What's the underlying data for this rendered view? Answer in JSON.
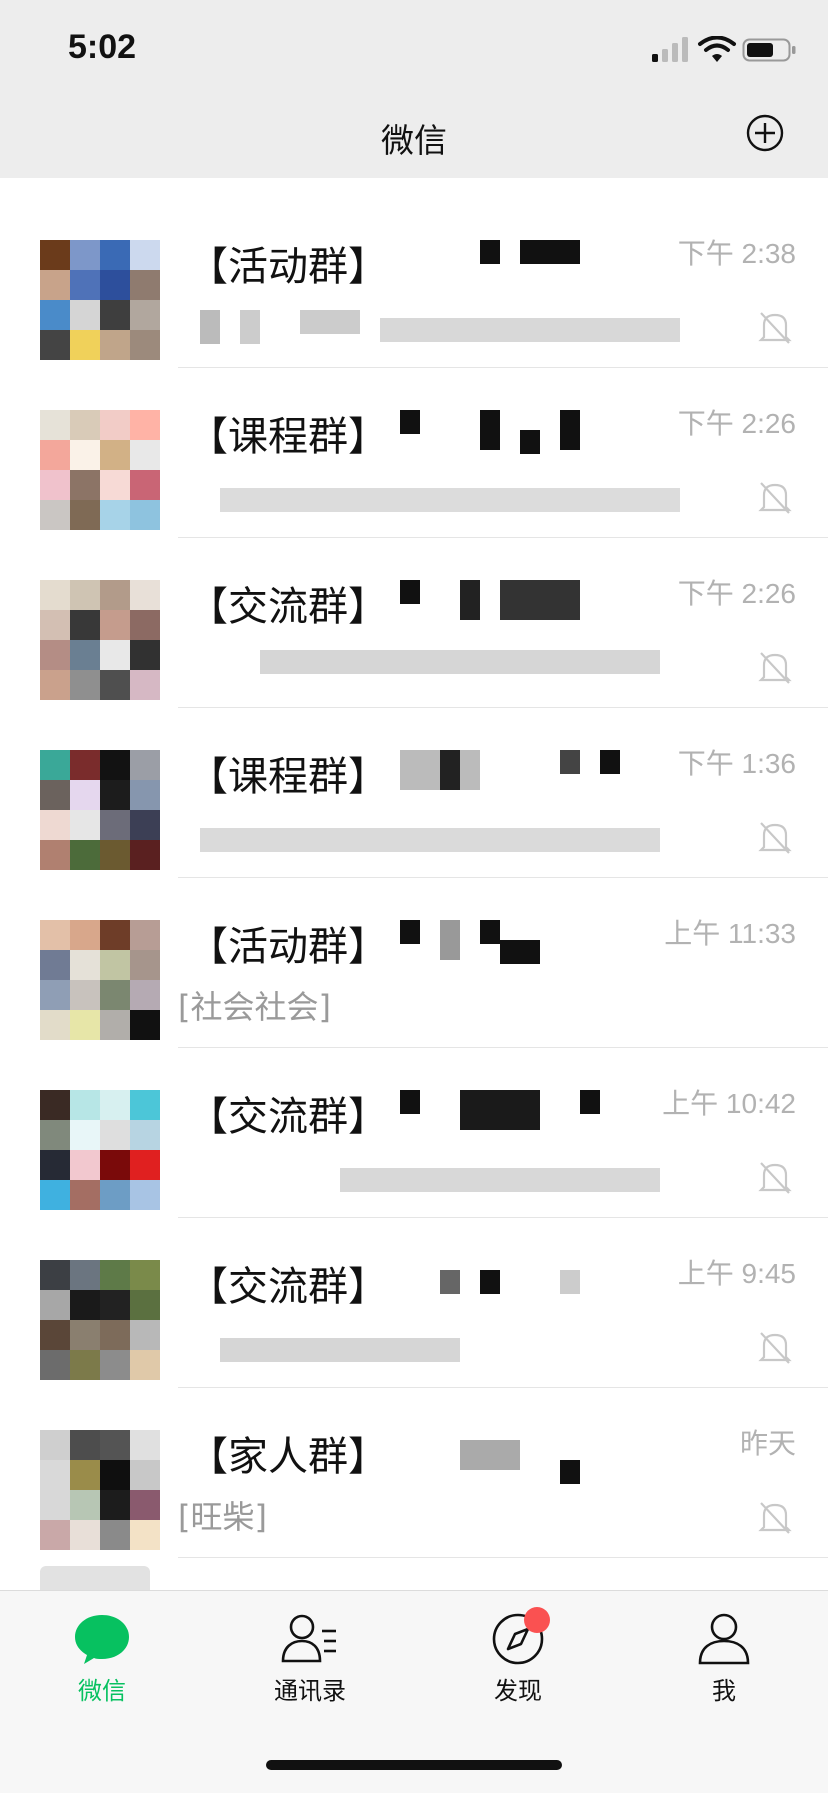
{
  "status_bar": {
    "time": "5:02"
  },
  "header": {
    "title": "微信"
  },
  "chats": [
    {
      "name": "【活动群】",
      "time": "下午 2:38",
      "preview": "",
      "muted": true,
      "avatar": [
        "#6b3b1b",
        "#7d97c9",
        "#3a6ab5",
        "#ccd9ee",
        "#c8a38a",
        "#4f72b8",
        "#2d4f9c",
        "#8f7b6f",
        "#4a8bc9",
        "#d5d5d5",
        "#3e3e3e",
        "#b1a79e",
        "#444444",
        "#f0d15a",
        "#c0a58a",
        "#9c8a7c"
      ]
    },
    {
      "name": "【课程群】",
      "time": "下午 2:26",
      "preview": "",
      "muted": true,
      "avatar": [
        "#e6e2d8",
        "#d9cbb8",
        "#f2ccc7",
        "#ffb3a6",
        "#f3a79b",
        "#faf2e8",
        "#d2b186",
        "#e8e8e8",
        "#f0c2cc",
        "#8c7466",
        "#f7dad6",
        "#c96575",
        "#cac6c3",
        "#7f6a55",
        "#a7d3e8",
        "#8ec3df"
      ]
    },
    {
      "name": "【交流群】",
      "time": "下午 2:26",
      "preview": "",
      "muted": true,
      "avatar": [
        "#e4dccf",
        "#cfc4b3",
        "#b29b8a",
        "#e8e0d8",
        "#d3bfb3",
        "#383838",
        "#c59c8d",
        "#8c6a63",
        "#b48d85",
        "#6a7f92",
        "#e8e8e8",
        "#313131",
        "#caa18c",
        "#8f8f8f",
        "#4f4f4f",
        "#d6b8c4"
      ]
    },
    {
      "name": "【课程群】",
      "time": "下午 1:36",
      "preview": "",
      "muted": true,
      "avatar": [
        "#3aa898",
        "#7a2c2c",
        "#121212",
        "#9b9ea6",
        "#6b625d",
        "#e5d7ee",
        "#1c1c1c",
        "#8696ae",
        "#eed9d2",
        "#e6e6e6",
        "#6c6c79",
        "#3c3f55",
        "#b08070",
        "#4c6b3a",
        "#6b5a30",
        "#5a2020"
      ]
    },
    {
      "name": "【活动群】",
      "time": "上午 11:33",
      "preview": "[社会社会]",
      "muted": false,
      "avatar": [
        "#e3c0a8",
        "#d8a78b",
        "#6e3d28",
        "#b79d95",
        "#707b94",
        "#e5e1d8",
        "#c1c5a3",
        "#a6958c",
        "#8f9eb5",
        "#c8c2bd",
        "#7b8770",
        "#b5aab3",
        "#e2dcc9",
        "#e7e6a8",
        "#b1aeaa",
        "#111111"
      ]
    },
    {
      "name": "【交流群】",
      "time": "上午 10:42",
      "preview": "",
      "muted": true,
      "avatar": [
        "#3a2a24",
        "#b7e6e6",
        "#d7f0f0",
        "#4cc6d8",
        "#80897c",
        "#e8f6f8",
        "#dedede",
        "#b7d4e2",
        "#262a35",
        "#f2c8cf",
        "#7a0a0a",
        "#e02020",
        "#3fb1e0",
        "#a46e63",
        "#6d9dc5",
        "#a8c4e4"
      ]
    },
    {
      "name": "【交流群】",
      "time": "上午 9:45",
      "preview": "",
      "muted": true,
      "avatar": [
        "#3c3f44",
        "#6b7580",
        "#5e7a48",
        "#7a8a4a",
        "#a7a7a7",
        "#1a1a1a",
        "#222222",
        "#5b7040",
        "#5a4638",
        "#8a7f6f",
        "#7d6b5a",
        "#b8b8b8",
        "#6c6c6c",
        "#7c7a4a",
        "#8c8c8c",
        "#e0c9a9"
      ]
    },
    {
      "name": "【家人群】",
      "time": "昨天",
      "preview": "[旺柴]",
      "muted": true,
      "avatar": [
        "#cfcfcf",
        "#4d4d4d",
        "#545454",
        "#e0e0e0",
        "#d9d9d9",
        "#9a8c4a",
        "#0f0f0f",
        "#c8c8c8",
        "#d8d8d8",
        "#b7c6b4",
        "#1c1c1c",
        "#8a5a6e",
        "#c9a8a8",
        "#e8dfd8",
        "#8a8a8a",
        "#f3e2c6"
      ]
    }
  ],
  "tabs": [
    {
      "label": "微信",
      "icon": "chat-bubble-icon",
      "active": true
    },
    {
      "label": "通讯录",
      "icon": "contacts-icon",
      "active": false
    },
    {
      "label": "发现",
      "icon": "compass-icon",
      "active": false,
      "badge": true
    },
    {
      "label": "我",
      "icon": "person-icon",
      "active": false
    }
  ],
  "colors": {
    "accent": "#07c160",
    "badge": "#fa5151",
    "muted": "#b2b2b2"
  }
}
